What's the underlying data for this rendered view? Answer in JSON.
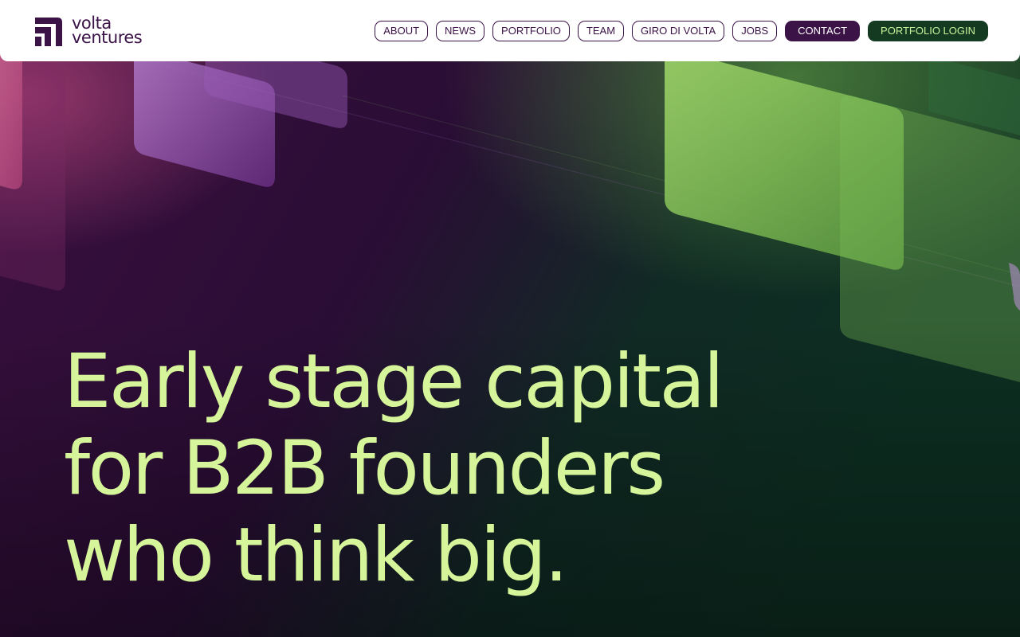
{
  "header": {
    "logo": {
      "line1": "volta",
      "line2": "ventures",
      "icon": "volta-logo-icon"
    },
    "nav": [
      {
        "label": "ABOUT"
      },
      {
        "label": "NEWS"
      },
      {
        "label": "PORTFOLIO"
      },
      {
        "label": "TEAM"
      },
      {
        "label": "GIRO DI VOLTA"
      },
      {
        "label": "JOBS"
      },
      {
        "label": "CONTACT"
      },
      {
        "label": "PORTFOLIO LOGIN"
      }
    ]
  },
  "hero": {
    "headline": [
      "Early stage capital",
      "for B2B founders",
      "who think big."
    ]
  },
  "colors": {
    "brand_purple": "#3b1347",
    "brand_green": "#143a22",
    "accent_lime": "#d6f59a",
    "header_bg": "#ffffff"
  }
}
